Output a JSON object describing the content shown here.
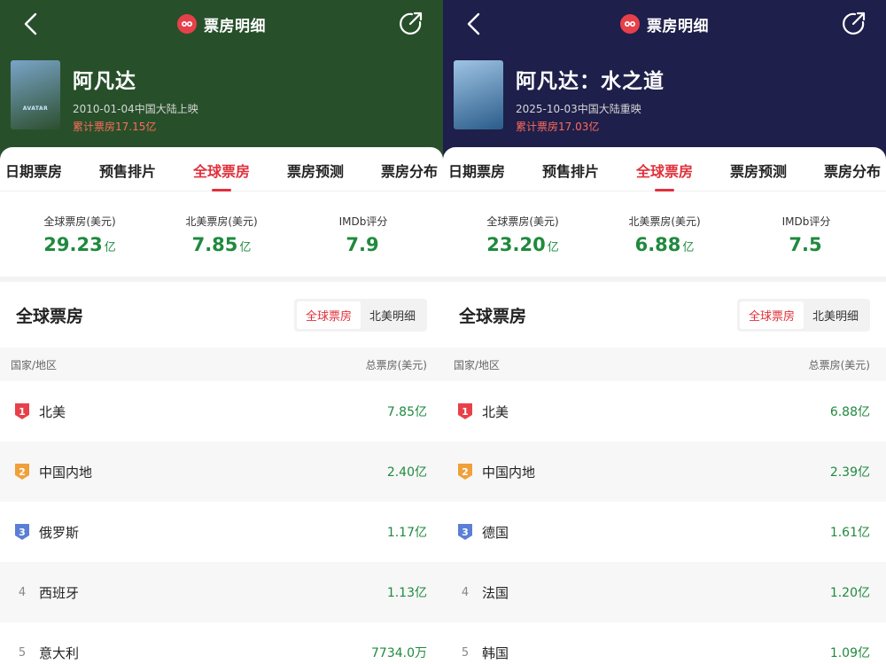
{
  "panels": [
    {
      "header_color": "#27502a",
      "poster_colors": [
        "#7aa4c9",
        "#2c4f2e"
      ],
      "poster_word": "AVATAR",
      "brand_title": "票房明细",
      "movie": {
        "title": "阿凡达",
        "release": "2010-01-04中国大陆上映",
        "cumulative": "累计票房17.15亿"
      },
      "tabs": [
        "日期票房",
        "预售排片",
        "全球票房",
        "票房预测",
        "票房分布"
      ],
      "active_tab": 2,
      "stats": [
        {
          "label": "全球票房(美元)",
          "value": "29.23",
          "unit": "亿"
        },
        {
          "label": "北美票房(美元)",
          "value": "7.85",
          "unit": "亿"
        },
        {
          "label": "IMDb评分",
          "value": "7.9",
          "unit": ""
        }
      ],
      "section_title": "全球票房",
      "toggle": [
        "全球票房",
        "北美明细"
      ],
      "table_headers": [
        "国家/地区",
        "总票房(美元)"
      ],
      "rows": [
        {
          "rank": "1",
          "country": "北美",
          "amount": "7.85亿"
        },
        {
          "rank": "2",
          "country": "中国内地",
          "amount": "2.40亿"
        },
        {
          "rank": "3",
          "country": "俄罗斯",
          "amount": "1.17亿"
        },
        {
          "rank": "4",
          "country": "西班牙",
          "amount": "1.13亿"
        },
        {
          "rank": "5",
          "country": "意大利",
          "amount": "7734.0万"
        }
      ]
    },
    {
      "header_color": "#1e1f4a",
      "poster_colors": [
        "#9fc4e4",
        "#2a5c8a"
      ],
      "poster_word": "",
      "brand_title": "票房明细",
      "movie": {
        "title": "阿凡达：水之道",
        "release": "2025-10-03中国大陆重映",
        "cumulative": "累计票房17.03亿"
      },
      "tabs": [
        "日期票房",
        "预售排片",
        "全球票房",
        "票房预测",
        "票房分布"
      ],
      "active_tab": 2,
      "stats": [
        {
          "label": "全球票房(美元)",
          "value": "23.20",
          "unit": "亿"
        },
        {
          "label": "北美票房(美元)",
          "value": "6.88",
          "unit": "亿"
        },
        {
          "label": "IMDb评分",
          "value": "7.5",
          "unit": ""
        }
      ],
      "section_title": "全球票房",
      "toggle": [
        "全球票房",
        "北美明细"
      ],
      "table_headers": [
        "国家/地区",
        "总票房(美元)"
      ],
      "rows": [
        {
          "rank": "1",
          "country": "北美",
          "amount": "6.88亿"
        },
        {
          "rank": "2",
          "country": "中国内地",
          "amount": "2.39亿"
        },
        {
          "rank": "3",
          "country": "德国",
          "amount": "1.61亿"
        },
        {
          "rank": "4",
          "country": "法国",
          "amount": "1.20亿"
        },
        {
          "rank": "5",
          "country": "韩国",
          "amount": "1.09亿"
        }
      ]
    }
  ],
  "colors": {
    "accent_red": "#e0303b",
    "value_green": "#1f8a3e",
    "rank_gold": "#f0a03a",
    "rank_silver": "#5a7fd6",
    "rank_top": "#e8404a"
  }
}
